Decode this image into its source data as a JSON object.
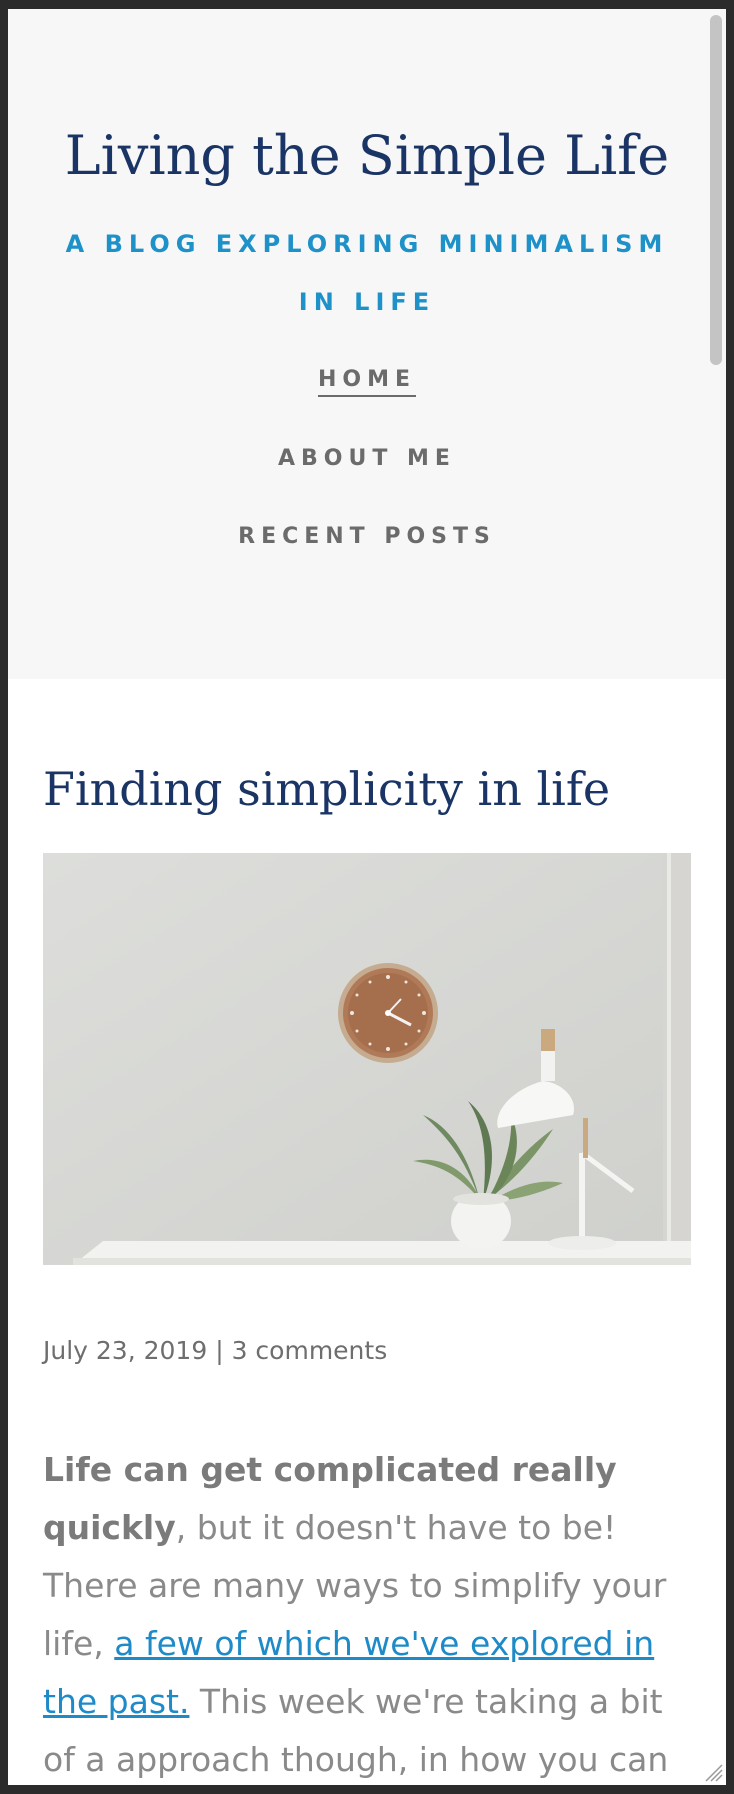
{
  "site": {
    "title": "Living the Simple Life",
    "tagline": "A BLOG EXPLORING MINIMALISM IN LIFE"
  },
  "nav": {
    "items": [
      {
        "label": "HOME",
        "active": true
      },
      {
        "label": "ABOUT ME",
        "active": false
      },
      {
        "label": "RECENT POSTS",
        "active": false
      }
    ]
  },
  "post": {
    "title": "Finding simplicity in life",
    "image_alt": "clock-lamp-plant-photo",
    "date": "July 23, 2019",
    "separator": "|",
    "comments": "3 comments",
    "body": {
      "bold": "Life can get complicated really quickly",
      "text1": ", but it doesn't have to be! There are many ways to simplify your life, ",
      "link": "a few of which we've explored in the past.",
      "text2": " This week we're taking a bit of a approach though, in how you can find"
    }
  },
  "colors": {
    "title": "#1a3565",
    "accent": "#1e91c8",
    "nav": "#6b6b6b",
    "header_bg": "#f7f7f7"
  }
}
